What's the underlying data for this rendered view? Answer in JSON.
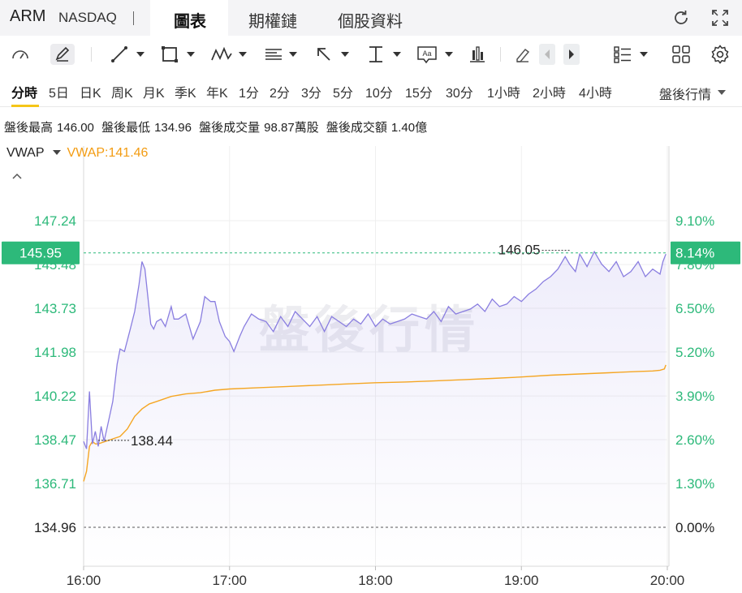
{
  "header": {
    "ticker": "ARM",
    "exchange": "NASDAQ",
    "tabs": [
      {
        "label": "圖表",
        "active": true
      },
      {
        "label": "期權鏈",
        "active": false
      },
      {
        "label": "個股資料",
        "active": false
      }
    ],
    "icons": [
      "refresh-icon",
      "fullscreen-icon"
    ]
  },
  "toolbar": {
    "icons": [
      "gauge-icon",
      "pencil-icon",
      "line-tool-icon",
      "rectangle-tool-icon",
      "pattern-tool-icon",
      "fibonacci-tool-icon",
      "arrow-tool-icon",
      "text-marker-icon",
      "text-box-icon",
      "bar-measure-icon",
      "eraser-icon",
      "prev-icon",
      "next-icon",
      "indicator-list-icon",
      "layout-grid-icon",
      "settings-icon"
    ]
  },
  "periods": {
    "items": [
      "分時",
      "5日",
      "日K",
      "周K",
      "月K",
      "季K",
      "年K",
      "1分",
      "2分",
      "3分",
      "5分",
      "10分",
      "15分",
      "30分",
      "1小時",
      "2小時",
      "4小時"
    ],
    "active": "分時",
    "session": "盤後行情"
  },
  "stats": {
    "high_label": "盤後最高",
    "high": "146.00",
    "low_label": "盤後最低",
    "low": "134.96",
    "volume_label": "盤後成交量",
    "volume": "98.87萬股",
    "turnover_label": "盤後成交額",
    "turnover": "1.40億"
  },
  "indicator": {
    "name": "VWAP",
    "value_text": "VWAP:141.46"
  },
  "colors": {
    "up": "#2db97a",
    "price_line": "#8a7ee0",
    "vwap_line": "#f5a623",
    "axis_text": "#2db97a"
  },
  "chart_data": {
    "type": "line",
    "watermark": "盤後行情",
    "x_ticks": [
      "16:00",
      "17:00",
      "18:00",
      "19:00",
      "20:00"
    ],
    "y_ticks_left": [
      "147.24",
      "145.48",
      "143.73",
      "141.98",
      "140.22",
      "138.47",
      "136.71",
      "134.96"
    ],
    "y_ticks_right": [
      "9.10%",
      "7.80%",
      "6.50%",
      "5.20%",
      "3.90%",
      "2.60%",
      "1.30%",
      "0.00%"
    ],
    "ylim": [
      134.96,
      147.24
    ],
    "base_price": 134.96,
    "current_price": "145.95",
    "current_pct": "8.14%",
    "high_marker": {
      "label": "146.05",
      "time": 19.33,
      "value": 146.05
    },
    "low_marker": {
      "label": "138.44",
      "time": 16.1,
      "value": 138.44
    },
    "series": [
      {
        "name": "price",
        "x": [
          16.0,
          16.02,
          16.04,
          16.06,
          16.08,
          16.1,
          16.12,
          16.14,
          16.17,
          16.2,
          16.23,
          16.25,
          16.28,
          16.32,
          16.35,
          16.38,
          16.4,
          16.42,
          16.44,
          16.46,
          16.48,
          16.5,
          16.53,
          16.56,
          16.6,
          16.62,
          16.65,
          16.7,
          16.75,
          16.8,
          16.83,
          16.87,
          16.9,
          16.93,
          16.97,
          17.0,
          17.03,
          17.07,
          17.1,
          17.15,
          17.2,
          17.25,
          17.3,
          17.35,
          17.4,
          17.45,
          17.5,
          17.55,
          17.6,
          17.65,
          17.7,
          17.75,
          17.8,
          17.85,
          17.9,
          17.95,
          18.0,
          18.05,
          18.1,
          18.15,
          18.2,
          18.25,
          18.3,
          18.35,
          18.4,
          18.45,
          18.5,
          18.55,
          18.6,
          18.65,
          18.7,
          18.75,
          18.8,
          18.85,
          18.9,
          18.95,
          19.0,
          19.05,
          19.1,
          19.15,
          19.2,
          19.25,
          19.3,
          19.33,
          19.37,
          19.4,
          19.45,
          19.5,
          19.55,
          19.6,
          19.65,
          19.7,
          19.75,
          19.8,
          19.85,
          19.9,
          19.95,
          19.97,
          19.99
        ],
        "values": [
          138.4,
          138.1,
          140.4,
          138.3,
          138.8,
          138.2,
          139.0,
          138.4,
          139.2,
          140.0,
          141.5,
          142.1,
          142.0,
          142.9,
          143.6,
          144.7,
          145.6,
          145.3,
          144.2,
          143.1,
          142.9,
          143.2,
          143.3,
          143.0,
          143.8,
          143.3,
          143.3,
          143.5,
          142.5,
          143.2,
          144.2,
          144.0,
          144.0,
          143.2,
          142.6,
          142.4,
          142.0,
          142.6,
          143.0,
          143.5,
          143.3,
          143.2,
          142.8,
          143.4,
          143.0,
          143.6,
          143.3,
          143.0,
          143.4,
          142.8,
          143.4,
          143.2,
          143.0,
          143.3,
          143.1,
          143.5,
          143.0,
          143.3,
          143.1,
          143.2,
          143.3,
          143.5,
          143.4,
          143.3,
          143.6,
          143.2,
          143.8,
          143.5,
          143.6,
          143.7,
          143.9,
          143.6,
          144.1,
          143.8,
          143.9,
          144.2,
          144.0,
          144.3,
          144.5,
          144.8,
          145.0,
          145.3,
          145.8,
          145.5,
          145.2,
          145.9,
          145.4,
          146.0,
          145.5,
          145.2,
          145.6,
          145.0,
          145.2,
          145.6,
          145.0,
          145.3,
          145.1,
          145.6,
          145.9
        ]
      },
      {
        "name": "VWAP",
        "x": [
          16.0,
          16.02,
          16.04,
          16.06,
          16.08,
          16.1,
          16.15,
          16.2,
          16.25,
          16.3,
          16.35,
          16.4,
          16.45,
          16.5,
          16.6,
          16.7,
          16.8,
          16.9,
          17.0,
          17.2,
          17.4,
          17.6,
          17.8,
          18.0,
          18.2,
          18.4,
          18.6,
          18.8,
          19.0,
          19.2,
          19.4,
          19.6,
          19.8,
          19.9,
          19.95,
          19.98,
          19.99
        ],
        "values": [
          136.8,
          137.2,
          138.2,
          138.4,
          138.3,
          138.3,
          138.4,
          138.5,
          138.6,
          138.9,
          139.4,
          139.7,
          139.9,
          140.0,
          140.2,
          140.3,
          140.35,
          140.45,
          140.5,
          140.55,
          140.6,
          140.65,
          140.7,
          140.75,
          140.78,
          140.82,
          140.87,
          140.92,
          140.98,
          141.05,
          141.1,
          141.15,
          141.2,
          141.22,
          141.25,
          141.3,
          141.46
        ]
      }
    ]
  }
}
